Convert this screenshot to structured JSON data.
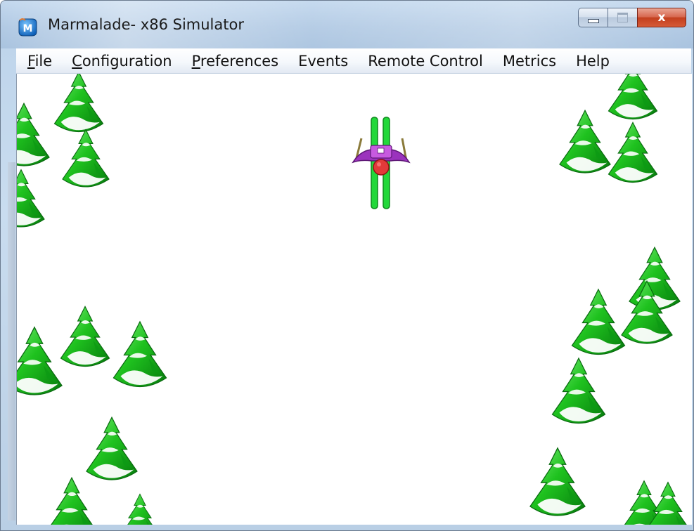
{
  "window": {
    "title": "Marmalade- x86 Simulator",
    "app_icon_letter": "M",
    "close_glyph": "x"
  },
  "menu": {
    "items": [
      {
        "label": "File",
        "mnemonic": "F"
      },
      {
        "label": "Configuration",
        "mnemonic": "C"
      },
      {
        "label": "Preferences",
        "mnemonic": "P"
      },
      {
        "label": "Events",
        "mnemonic": ""
      },
      {
        "label": "Remote Control",
        "mnemonic": ""
      },
      {
        "label": "Metrics",
        "mnemonic": ""
      },
      {
        "label": "Help",
        "mnemonic": ""
      }
    ]
  },
  "game": {
    "background": "#ffffff",
    "tree_colors": {
      "dark": "#0a8a10",
      "mid": "#1fc21f",
      "light": "#7cf07a",
      "snow": "#ffffff"
    },
    "skier_colors": {
      "skis": "#22d83a",
      "body": "#a23bc2",
      "head": "#e23a3a",
      "poles": "#8a7a3a"
    },
    "icons": [
      "pine-tree-icon",
      "skier-icon"
    ]
  }
}
